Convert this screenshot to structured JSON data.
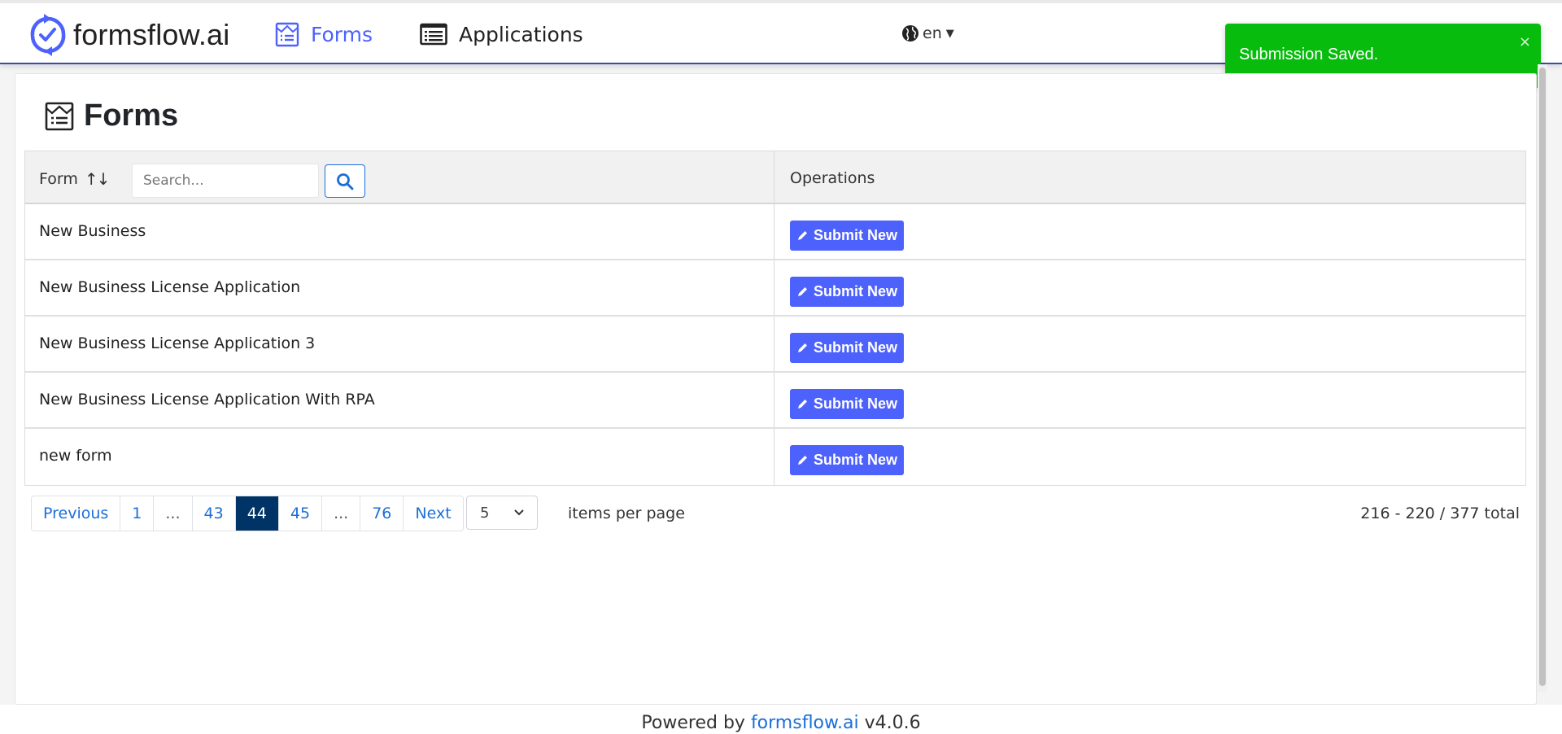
{
  "navbar": {
    "brand": "formsflow.ai",
    "items": [
      {
        "label": "Forms",
        "icon": "forms-icon",
        "active": true
      },
      {
        "label": "Applications",
        "icon": "list-icon",
        "active": false
      }
    ],
    "language": "en",
    "accent_color": "#4d61fc"
  },
  "toast": {
    "message": "Submission Saved.",
    "close": "×",
    "progress": 0.58,
    "color": "#07bc0c"
  },
  "page": {
    "title": "Forms"
  },
  "table": {
    "columns": {
      "form": "Form",
      "operations": "Operations"
    },
    "search_placeholder": "Search...",
    "rows": [
      {
        "name": "New Business",
        "action": "Submit New"
      },
      {
        "name": "New Business License Application",
        "action": "Submit New"
      },
      {
        "name": "New Business License Application 3",
        "action": "Submit New"
      },
      {
        "name": "New Business License Application With RPA",
        "action": "Submit New"
      },
      {
        "name": "new form",
        "action": "Submit New"
      }
    ]
  },
  "pagination": {
    "previous": "Previous",
    "next": "Next",
    "pages": [
      "1",
      "...",
      "43",
      "44",
      "45",
      "...",
      "76"
    ],
    "active": "44",
    "per_page": "5",
    "per_page_label": "items per page",
    "total": "216 - 220 / 377 total"
  },
  "footer": {
    "prefix": "Powered by",
    "link": "formsflow.ai",
    "version": "v4.0.6"
  }
}
